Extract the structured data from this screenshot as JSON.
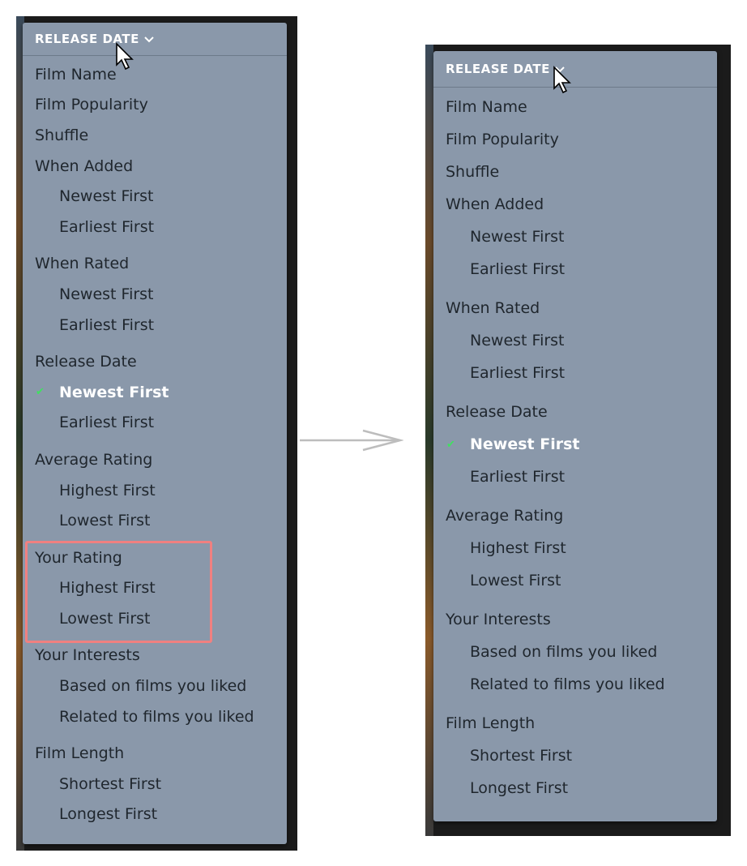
{
  "header_label": "RELEASE DATE",
  "colors": {
    "menu_bg": "#8a98aa",
    "highlight": "#f08080",
    "check": "#40e060"
  },
  "left_menu": {
    "groups": [
      {
        "title": "Film Name",
        "options": []
      },
      {
        "title": "Film Popularity",
        "options": []
      },
      {
        "title": "Shuffle",
        "options": []
      },
      {
        "title": "When Added",
        "options": [
          "Newest First",
          "Earliest First"
        ]
      },
      {
        "title": "When Rated",
        "options": [
          "Newest First",
          "Earliest First"
        ]
      },
      {
        "title": "Release Date",
        "options": [
          "Newest First",
          "Earliest First"
        ]
      },
      {
        "title": "Average Rating",
        "options": [
          "Highest First",
          "Lowest First"
        ]
      },
      {
        "title": "Your Rating",
        "options": [
          "Highest First",
          "Lowest First"
        ]
      },
      {
        "title": "Your Interests",
        "options": [
          "Based on films you liked",
          "Related to films you liked"
        ]
      },
      {
        "title": "Film Length",
        "options": [
          "Shortest First",
          "Longest First"
        ]
      }
    ],
    "selected": {
      "group": "Release Date",
      "option": "Newest First"
    },
    "highlighted_group": "Your Rating"
  },
  "right_menu": {
    "groups": [
      {
        "title": "Film Name",
        "options": []
      },
      {
        "title": "Film Popularity",
        "options": []
      },
      {
        "title": "Shuffle",
        "options": []
      },
      {
        "title": "When Added",
        "options": [
          "Newest First",
          "Earliest First"
        ]
      },
      {
        "title": "When Rated",
        "options": [
          "Newest First",
          "Earliest First"
        ]
      },
      {
        "title": "Release Date",
        "options": [
          "Newest First",
          "Earliest First"
        ]
      },
      {
        "title": "Average Rating",
        "options": [
          "Highest First",
          "Lowest First"
        ]
      },
      {
        "title": "Your Interests",
        "options": [
          "Based on films you liked",
          "Related to films you liked"
        ]
      },
      {
        "title": "Film Length",
        "options": [
          "Shortest First",
          "Longest First"
        ]
      }
    ],
    "selected": {
      "group": "Release Date",
      "option": "Newest First"
    }
  },
  "icons": [
    "chevron-down-icon",
    "mouse-cursor-icon",
    "checkmark-icon",
    "right-arrow-icon"
  ]
}
